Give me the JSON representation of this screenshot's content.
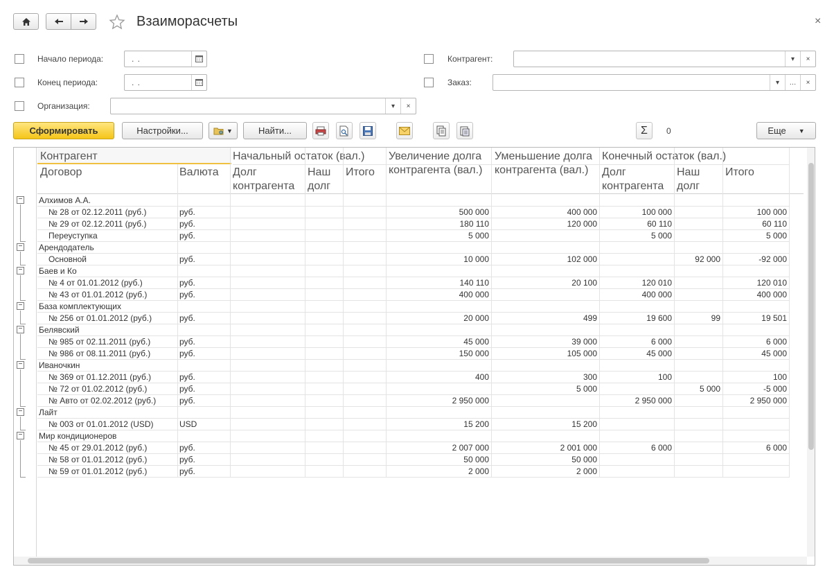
{
  "window": {
    "title": "Взаиморасчеты",
    "close_glyph": "×"
  },
  "icons": {
    "home": "home-icon",
    "back": "arrow-left-icon",
    "forward": "arrow-right-icon",
    "favorite": "star-icon"
  },
  "filters": {
    "period_start_label": "Начало периода:",
    "period_start_value": ". .",
    "period_end_label": "Конец периода:",
    "period_end_value": ". .",
    "organization_label": "Организация:",
    "counterparty_label": "Контрагент:",
    "order_label": "Заказ:"
  },
  "toolbar": {
    "generate_label": "Сформировать",
    "settings_label": "Настройки...",
    "find_label": "Найти...",
    "sum_glyph": "Σ",
    "sum_value": "0",
    "more_label": "Еще"
  },
  "report": {
    "header": {
      "counterparty": "Контрагент",
      "contract": "Договор",
      "currency": "Валюта",
      "opening": "Начальный остаток (вал.)",
      "opening_debt_cp": "Долг контрагента",
      "opening_our_debt": "Наш долг",
      "opening_total": "Итого",
      "increase": "Увеличение долга контрагента (вал.)",
      "decrease": "Уменьшение долга контрагента (вал.)",
      "closing": "Конечный остаток (вал.)",
      "closing_debt_cp": "Долг контрагента",
      "closing_our_debt": "Наш долг",
      "closing_total": "Итого"
    },
    "groups": [
      {
        "name": "Алхимов А.А.",
        "rows": [
          {
            "contract": "№ 28 от 02.12.2011 (руб.)",
            "currency": "руб.",
            "inc": "500 000",
            "dec": "400 000",
            "cdebt": "100 000",
            "cour": "",
            "ctotal": "100 000"
          },
          {
            "contract": "№ 29 от 02.12.2011 (руб.)",
            "currency": "руб.",
            "inc": "180 110",
            "dec": "120 000",
            "cdebt": "60 110",
            "cour": "",
            "ctotal": "60 110"
          },
          {
            "contract": "Переуступка",
            "currency": "руб.",
            "inc": "5 000",
            "dec": "",
            "cdebt": "5 000",
            "cour": "",
            "ctotal": "5 000"
          }
        ]
      },
      {
        "name": "Арендодатель",
        "rows": [
          {
            "contract": "Основной",
            "currency": "руб.",
            "inc": "10 000",
            "dec": "102 000",
            "cdebt": "",
            "cour": "92 000",
            "ctotal": "-92 000"
          }
        ]
      },
      {
        "name": "Баев и Ко",
        "rows": [
          {
            "contract": "№ 4 от 01.01.2012 (руб.)",
            "currency": "руб.",
            "inc": "140 110",
            "dec": "20 100",
            "cdebt": "120 010",
            "cour": "",
            "ctotal": "120 010"
          },
          {
            "contract": "№ 43 от 01.01.2012 (руб.)",
            "currency": "руб.",
            "inc": "400 000",
            "dec": "",
            "cdebt": "400 000",
            "cour": "",
            "ctotal": "400 000"
          }
        ]
      },
      {
        "name": "База комплектующих",
        "rows": [
          {
            "contract": "№ 256 от 01.01.2012 (руб.)",
            "currency": "руб.",
            "inc": "20 000",
            "dec": "499",
            "cdebt": "19 600",
            "cour": "99",
            "ctotal": "19 501"
          }
        ]
      },
      {
        "name": "Белявский",
        "rows": [
          {
            "contract": "№ 985 от 02.11.2011 (руб.)",
            "currency": "руб.",
            "inc": "45 000",
            "dec": "39 000",
            "cdebt": "6 000",
            "cour": "",
            "ctotal": "6 000"
          },
          {
            "contract": "№ 986 от 08.11.2011 (руб.)",
            "currency": "руб.",
            "inc": "150 000",
            "dec": "105 000",
            "cdebt": "45 000",
            "cour": "",
            "ctotal": "45 000"
          }
        ]
      },
      {
        "name": "Иваночкин",
        "rows": [
          {
            "contract": "№ 369 от 01.12.2011 (руб.)",
            "currency": "руб.",
            "inc": "400",
            "dec": "300",
            "cdebt": "100",
            "cour": "",
            "ctotal": "100"
          },
          {
            "contract": "№ 72 от 01.02.2012 (руб.)",
            "currency": "руб.",
            "inc": "",
            "dec": "5 000",
            "cdebt": "",
            "cour": "5 000",
            "ctotal": "-5 000"
          },
          {
            "contract": "№ Авто от 02.02.2012 (руб.)",
            "currency": "руб.",
            "inc": "2 950 000",
            "dec": "",
            "cdebt": "2 950 000",
            "cour": "",
            "ctotal": "2 950 000"
          }
        ]
      },
      {
        "name": "Лайт",
        "rows": [
          {
            "contract": "№ 003 от 01.01.2012 (USD)",
            "currency": "USD",
            "inc": "15 200",
            "dec": "15 200",
            "cdebt": "",
            "cour": "",
            "ctotal": ""
          }
        ]
      },
      {
        "name": "Мир кондиционеров",
        "rows": [
          {
            "contract": "№ 45 от 29.01.2012 (руб.)",
            "currency": "руб.",
            "inc": "2 007 000",
            "dec": "2 001 000",
            "cdebt": "6 000",
            "cour": "",
            "ctotal": "6 000"
          },
          {
            "contract": "№ 58 от 01.01.2012 (руб.)",
            "currency": "руб.",
            "inc": "50 000",
            "dec": "50 000",
            "cdebt": "",
            "cour": "",
            "ctotal": ""
          },
          {
            "contract": "№ 59 от 01.01.2012 (руб.)",
            "currency": "руб.",
            "inc": "2 000",
            "dec": "2 000",
            "cdebt": "",
            "cour": "",
            "ctotal": ""
          }
        ]
      }
    ],
    "collapse_glyph": "−"
  },
  "colors": {
    "primary_button": "#f5c518",
    "header_underline": "#f0c040"
  }
}
